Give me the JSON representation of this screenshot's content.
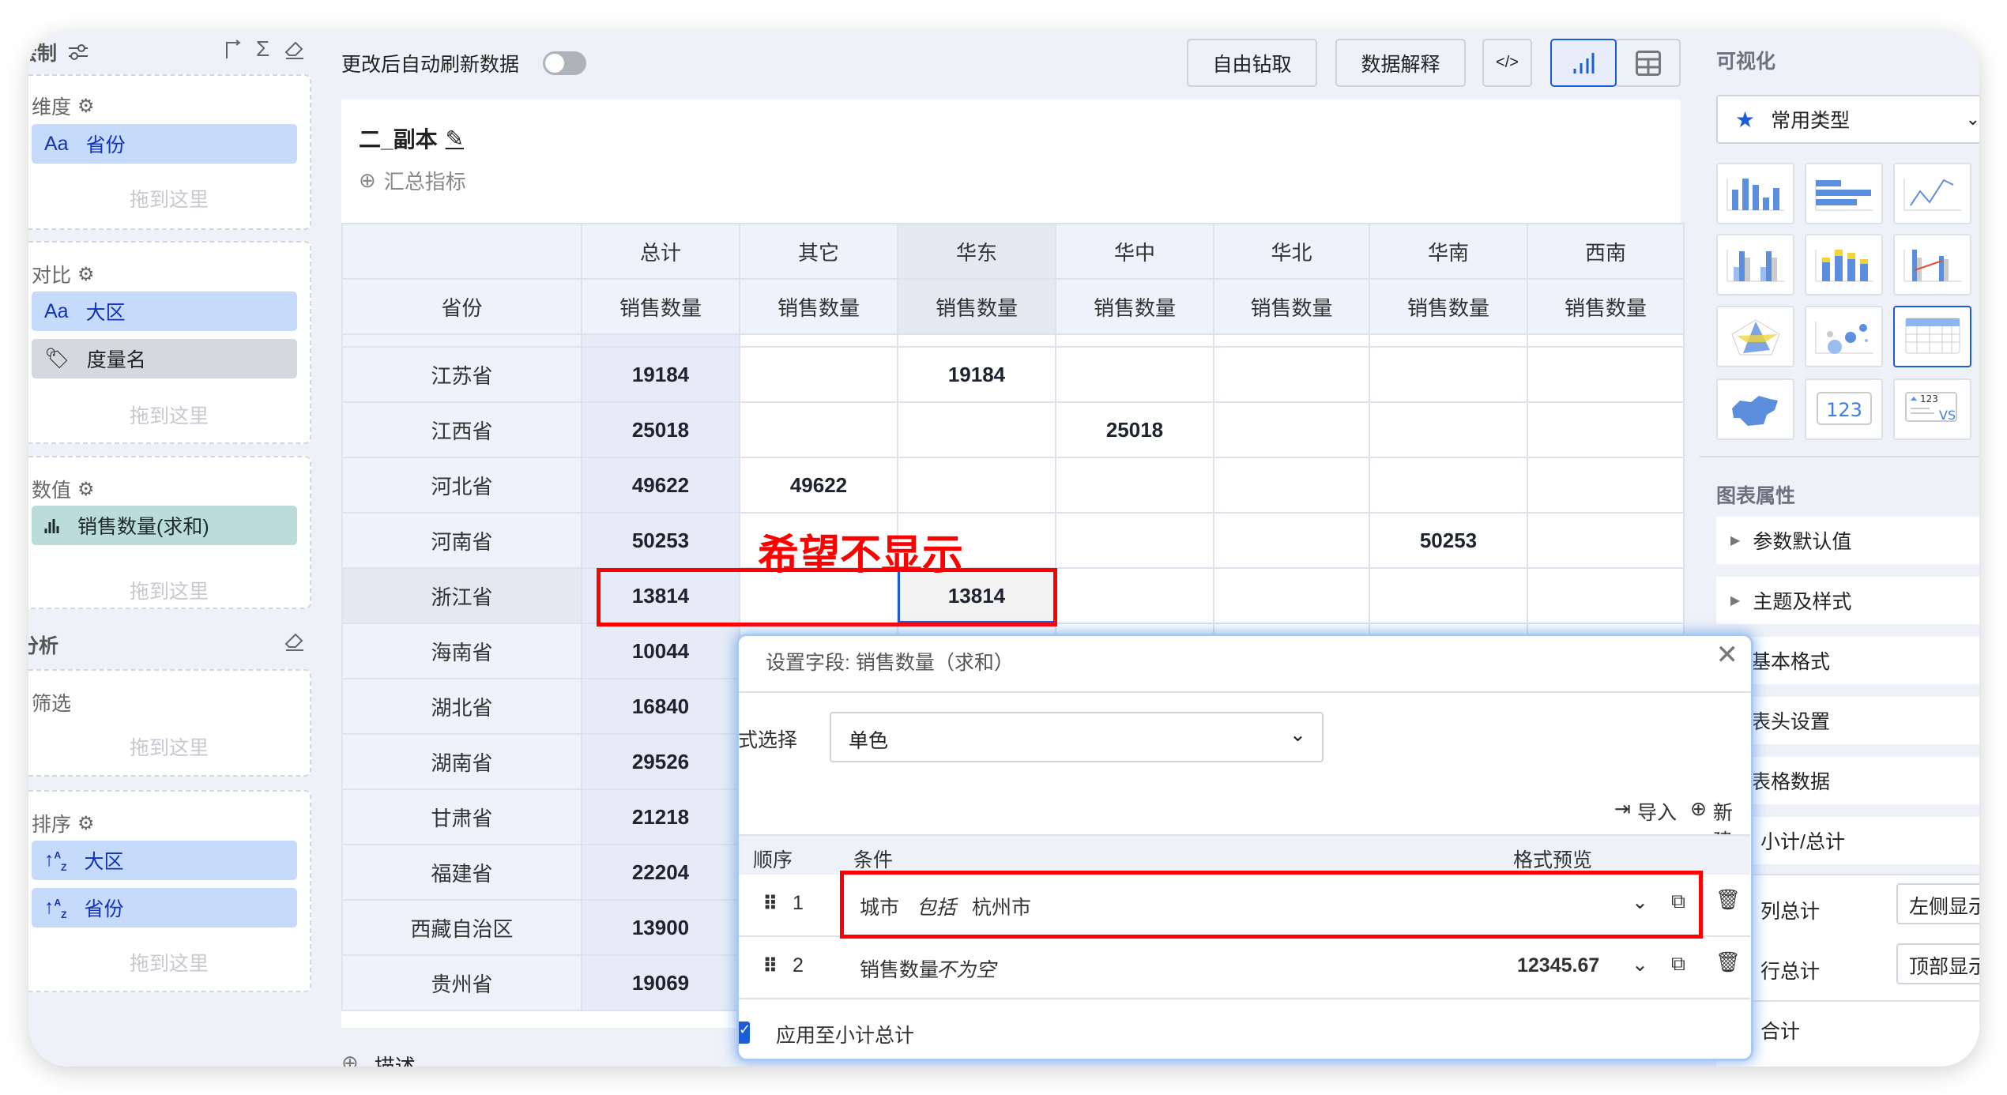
{
  "left_panel": {
    "header": "绘制",
    "dimension": {
      "label": "维度",
      "pill": "省份",
      "pill_icon": "Aa",
      "drop": "拖到这里"
    },
    "compare": {
      "label": "对比",
      "pills": [
        "大区",
        "度量名"
      ],
      "pill_icon": "Aa",
      "drop": "拖到这里"
    },
    "value": {
      "label": "数值",
      "pill": "销售数量(求和)",
      "drop": "拖到这里"
    },
    "analysis_header": "分析",
    "filter": {
      "label": "筛选",
      "drop": "拖到这里"
    },
    "sort": {
      "label": "排序",
      "pills": [
        "大区",
        "省份"
      ],
      "drop": "拖到这里"
    }
  },
  "toolbar": {
    "auto_refresh_label": "更改后自动刷新数据",
    "auto_refresh_on": false,
    "drill_button": "自由钻取",
    "explain_button": "数据解释",
    "code_button": "</>",
    "view_mode": "chart"
  },
  "chart": {
    "title": "二_副本",
    "add_summary": "汇总指标",
    "describe": "描述"
  },
  "table": {
    "col_groups": [
      "",
      "总计",
      "其它",
      "华东",
      "华中",
      "华北",
      "华南",
      "西南"
    ],
    "col_measures": [
      "省份",
      "销售数量",
      "销售数量",
      "销售数量",
      "销售数量",
      "销售数量",
      "销售数量",
      "销售数量"
    ],
    "rows": [
      [
        "江苏省",
        "19184",
        "",
        "19184",
        "",
        "",
        "",
        ""
      ],
      [
        "江西省",
        "25018",
        "",
        "",
        "25018",
        "",
        "",
        ""
      ],
      [
        "河北省",
        "49622",
        "49622",
        "",
        "",
        "",
        "",
        ""
      ],
      [
        "河南省",
        "50253",
        "",
        "",
        "",
        "",
        "50253",
        ""
      ],
      [
        "浙江省",
        "13814",
        "",
        "13814",
        "",
        "",
        "",
        ""
      ],
      [
        "海南省",
        "10044",
        "",
        "",
        "",
        "",
        "",
        ""
      ],
      [
        "湖北省",
        "16840",
        "",
        "",
        "",
        "",
        "",
        ""
      ],
      [
        "湖南省",
        "29526",
        "",
        "",
        "",
        "",
        "",
        ""
      ],
      [
        "甘肃省",
        "21218",
        "",
        "",
        "",
        "",
        "",
        ""
      ],
      [
        "福建省",
        "22204",
        "",
        "",
        "",
        "",
        "",
        ""
      ],
      [
        "西藏自治区",
        "13900",
        "",
        "",
        "",
        "",
        "",
        ""
      ],
      [
        "贵州省",
        "19069",
        "",
        "",
        "",
        "",
        "",
        ""
      ]
    ],
    "selected_row": 4
  },
  "annotation": {
    "text": "希望不显示",
    "color": "#ff0000"
  },
  "right_panel": {
    "visualization_title": "可视化",
    "chart_type_select": "常用类型",
    "chart_types": [
      "column-chart",
      "bar-chart",
      "line-chart",
      "grouped-column-chart",
      "stacked-column-chart",
      "combo-chart",
      "radar-chart",
      "bubble-chart",
      "table-chart",
      "map-chart",
      "kpi-number",
      "kpi-compare"
    ],
    "active_chart_type": "table-chart",
    "kpi_number_text": "123",
    "kpi_compare_text": "123",
    "kpi_compare_vs": "VS",
    "properties_title": "图表属性",
    "properties": [
      "参数默认值",
      "主题及样式",
      "基本格式",
      "表头设置",
      "表格数据",
      "小计/总计"
    ],
    "subtotal_rows": [
      {
        "label": "列总计",
        "value": "左侧显示"
      },
      {
        "label": "行总计",
        "value": "顶部显示"
      }
    ],
    "more": "合计"
  },
  "dialog": {
    "title": "设置字段: 销售数量（求和）",
    "style_label": "样式选择",
    "style_value": "单色",
    "import": "导入",
    "new": "新建",
    "headers": [
      "顺序",
      "条件",
      "格式预览"
    ],
    "rules": [
      {
        "order": "1",
        "field": "城市",
        "op": "包括",
        "value": "杭州市",
        "preview": ""
      },
      {
        "order": "2",
        "field": "销售数量",
        "op": "不为空",
        "value": "",
        "preview": "12345.67"
      }
    ],
    "apply_subtotal": "应用至小计总计",
    "apply_subtotal_checked": true
  },
  "colors": {
    "accent": "#1a5dd8",
    "pill_blue": "#c6dafc",
    "pill_teal": "#bcdcdb",
    "panel_bg": "#eef1f8"
  }
}
